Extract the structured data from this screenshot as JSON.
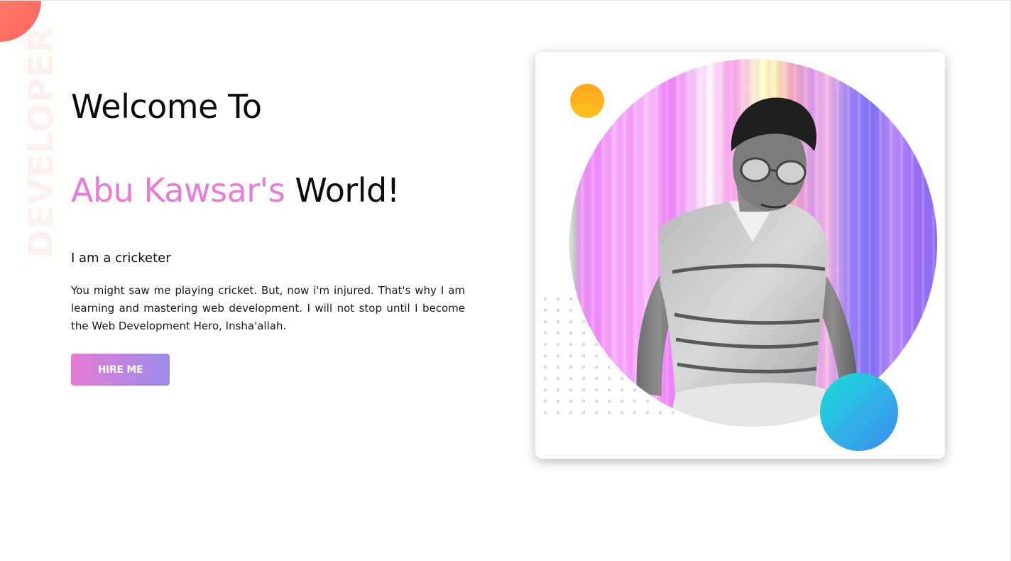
{
  "sidebar_word": "DEVELOPER",
  "hero": {
    "title_line1": "Welcome To",
    "title_name": "Abu Kawsar's",
    "title_rest": " World!",
    "subheading": "I am a cricketer",
    "intro": "You might saw me playing cricket. But, now i'm injured. That's why I am learning and mastering web development. I will not stop until I become the Web Development Hero, Insha'allah.",
    "cta_label": "HIRE ME"
  },
  "colors": {
    "accent_pink": "#ea7ad8",
    "button_gradient_start": "#e57bd3",
    "button_gradient_end": "#9b8cec",
    "corner_blob": "#ff6f61",
    "orange_circle": "#ffb01e",
    "teal_circle": "#2fb3e6"
  },
  "icons": {
    "corner_decoration": "coral-circle",
    "profile_photo": "portrait-photo"
  }
}
